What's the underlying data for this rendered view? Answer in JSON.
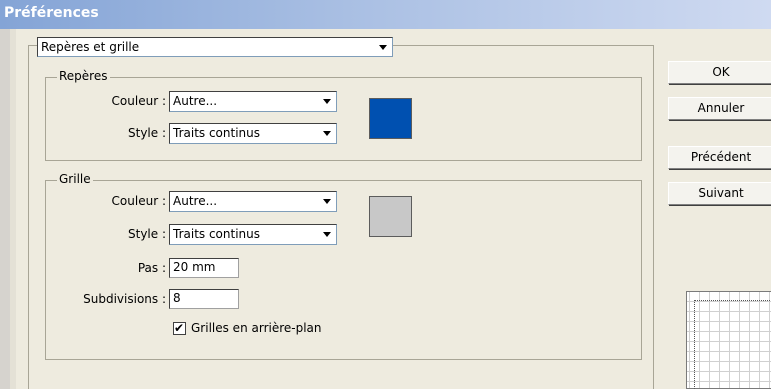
{
  "window": {
    "title": "Préférences"
  },
  "category_select": {
    "value": "Repères et grille"
  },
  "guides": {
    "legend": "Repères",
    "color_label": "Couleur :",
    "color_value": "Autre...",
    "style_label": "Style :",
    "style_value": "Traits continus",
    "swatch_color": "#0050b0"
  },
  "grid": {
    "legend": "Grille",
    "color_label": "Couleur :",
    "color_value": "Autre...",
    "style_label": "Style :",
    "style_value": "Traits continus",
    "spacing_label": "Pas :",
    "spacing_value": "20 mm",
    "subdivisions_label": "Subdivisions :",
    "subdivisions_value": "8",
    "background_checkbox_label": "Grilles en arrière-plan",
    "background_checkbox_checked": true,
    "swatch_color": "#c8c8c8"
  },
  "buttons": {
    "ok": "OK",
    "cancel": "Annuler",
    "previous": "Précédent",
    "next": "Suivant"
  }
}
